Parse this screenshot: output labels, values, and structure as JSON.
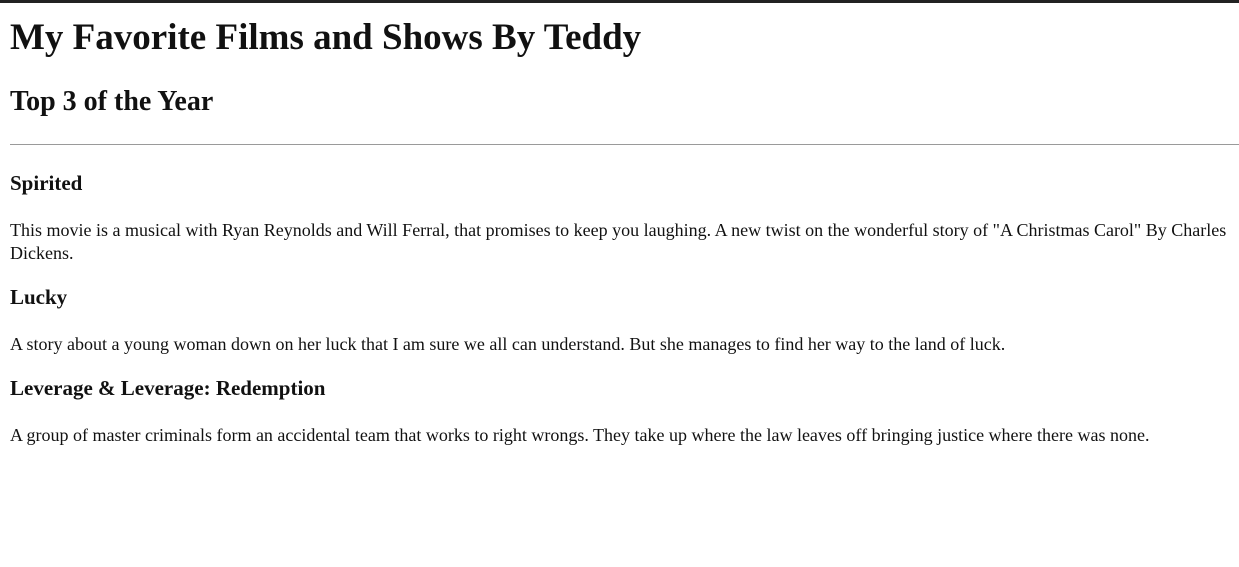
{
  "page": {
    "title": "My Favorite Films and Shows By Teddy",
    "subtitle": "Top 3 of the Year"
  },
  "entries": [
    {
      "title": "Spirited",
      "description": "This movie is a musical with Ryan Reynolds and Will Ferral, that promises to keep you laughing. A new twist on the wonderful story of \"A Christmas Carol\" By Charles Dickens."
    },
    {
      "title": "Lucky",
      "description": "A story about a young woman down on her luck that I am sure we all can understand. But she manages to find her way to the land of luck."
    },
    {
      "title": "Leverage & Leverage: Redemption",
      "description": "A group of master criminals form an accidental team that works to right wrongs. They take up where the law leaves off bringing justice where there was none."
    }
  ],
  "colors": {
    "text": "#111111",
    "divider": "#9a9a9a",
    "top_border": "#222222",
    "background": "#ffffff"
  }
}
